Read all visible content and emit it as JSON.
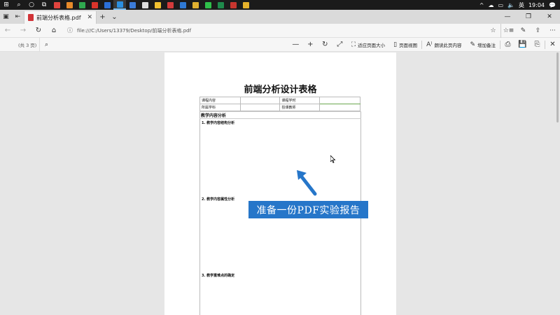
{
  "taskbar": {
    "apps": [
      {
        "icon": "start-icon",
        "color": "#ffffff"
      },
      {
        "icon": "search-icon",
        "color": "#ffffff"
      },
      {
        "icon": "cortana-icon",
        "color": "#ffffff"
      },
      {
        "icon": "task-view-icon",
        "color": "#ffffff"
      },
      {
        "icon": "app-red-icon",
        "color": "#e0443e"
      },
      {
        "icon": "app-orange-icon",
        "color": "#e88a2a"
      },
      {
        "icon": "app-green-icon",
        "color": "#2fa84f"
      },
      {
        "icon": "app-red2-icon",
        "color": "#d9342b"
      },
      {
        "icon": "app-blue-icon",
        "color": "#2b6fd8"
      },
      {
        "icon": "edge-icon",
        "color": "#2b8fe0"
      },
      {
        "icon": "app-blue2-icon",
        "color": "#3b7bd8"
      },
      {
        "icon": "app-white-icon",
        "color": "#dddddd"
      },
      {
        "icon": "app-yellow-icon",
        "color": "#f0c030"
      },
      {
        "icon": "app-red3-icon",
        "color": "#d33b3b"
      },
      {
        "icon": "app-blue3-icon",
        "color": "#2f79d4"
      },
      {
        "icon": "chrome-icon",
        "color": "#e0b030"
      },
      {
        "icon": "wechat-icon",
        "color": "#2fbf4a"
      },
      {
        "icon": "excel-icon",
        "color": "#1f8a4c"
      },
      {
        "icon": "app-red4-icon",
        "color": "#c8362f"
      },
      {
        "icon": "app-yellow2-icon",
        "color": "#e6b22c"
      }
    ],
    "tray": {
      "chevron": "^",
      "weather": "☁",
      "network": "▭",
      "volume": "🔈",
      "ime": "英",
      "time": "19:04",
      "notifications": "💬"
    }
  },
  "tabbar": {
    "tab_title": "前端分析表格.pdf",
    "close": "✕",
    "new_tab": "+",
    "tab_menu": "⌄",
    "minimize": "—",
    "restore": "❐",
    "close_window": "✕"
  },
  "addressbar": {
    "back": "←",
    "forward": "→",
    "refresh": "↻",
    "home": "⌂",
    "url": "file:///C:/Users/13379/Desktop/前端分析表格.pdf",
    "favorite": "☆",
    "favorites_bar": "☆≡",
    "notes": "✎",
    "share": "⇪",
    "more": "···"
  },
  "pdfbar": {
    "page_count": "(共 3 页)",
    "zoom_out": "—",
    "zoom_in": "+",
    "rotate": "↻",
    "fullscreen": "⤢",
    "fit_page": "适应页面大小",
    "page_view": "页面视图",
    "read_aloud": "朗读此页内容",
    "add_notes": "增加备注",
    "print": "⎙",
    "save": "💾",
    "save_as": "⎘",
    "pin": "✕"
  },
  "document": {
    "title": "前端分析设计表格",
    "table": [
      [
        "课程内容",
        "",
        "课程学时",
        ""
      ],
      [
        "所属学科",
        "",
        "授课教师",
        ""
      ]
    ],
    "section_title": "教学内容分析",
    "items": [
      "1. 教学内容结构分析",
      "2. 教学内容属性分析",
      "3. 教学重难点的确定"
    ]
  },
  "overlay": {
    "banner_text": "准备一份PDF实验报告",
    "banner_color": "#2676c9",
    "arrow_color": "#2676c9"
  }
}
